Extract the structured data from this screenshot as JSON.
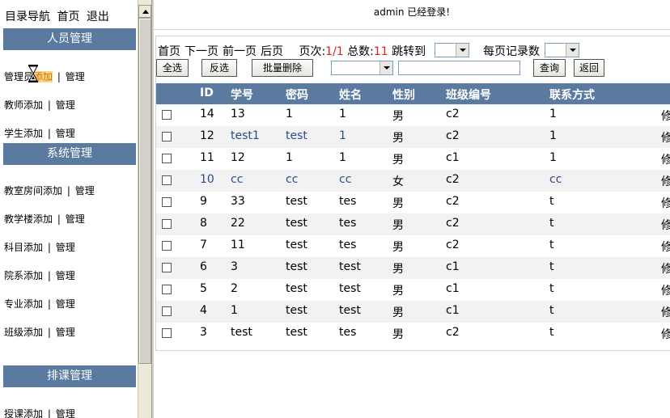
{
  "top_nav": [
    "目录导航",
    "首页",
    "退出"
  ],
  "sections": {
    "personnel": "人员管理",
    "system": "系统管理",
    "scheduling": "排课管理"
  },
  "menu": {
    "admin": {
      "prefix": "管理员",
      "add": "添加",
      "manage": "管理"
    },
    "teacher": {
      "add": "教师添加",
      "manage": "管理"
    },
    "student": {
      "add": "学生添加",
      "manage": "管理"
    },
    "classroom": {
      "add": "教室房间添加",
      "manage": "管理"
    },
    "building": {
      "add": "教学楼添加",
      "manage": "管理"
    },
    "subject": {
      "add": "科目添加",
      "manage": "管理"
    },
    "department": {
      "add": "院系添加",
      "manage": "管理"
    },
    "major": {
      "add": "专业添加",
      "manage": "管理"
    },
    "class": {
      "add": "班级添加",
      "manage": "管理"
    },
    "teaching": {
      "add": "授课添加",
      "manage": "管理"
    }
  },
  "separator": "|",
  "login_message": "admin 已经登录!",
  "pager": {
    "first": "首页",
    "next": "下一页",
    "prev": "前一页",
    "last": "后页",
    "page_label": "页次:",
    "page_value": "1/1",
    "total_label": "总数:",
    "total_value": "11",
    "jump_label": "跳转到",
    "per_page_label": "每页记录数"
  },
  "buttons": {
    "select_all": "全选",
    "invert": "反选",
    "batch_delete": "批量删除",
    "query": "查询",
    "back": "返回"
  },
  "columns": [
    "ID",
    "学号",
    "密码",
    "姓名",
    "性别",
    "班级编号",
    "联系方式"
  ],
  "rows": [
    {
      "id": "14",
      "no": "13",
      "pw": "1",
      "name": "1",
      "sex": "男",
      "class": "c2",
      "phone": "1",
      "op": "修"
    },
    {
      "id": "12",
      "no": "test1",
      "pw": "test",
      "name": "1",
      "sex": "男",
      "class": "c2",
      "phone": "1",
      "op": "修"
    },
    {
      "id": "11",
      "no": "12",
      "pw": "1",
      "name": "1",
      "sex": "男",
      "class": "c1",
      "phone": "1",
      "op": "修"
    },
    {
      "id": "10",
      "no": "cc",
      "pw": "cc",
      "name": "cc",
      "sex": "女",
      "class": "c2",
      "phone": "cc",
      "op": "修"
    },
    {
      "id": "9",
      "no": "33",
      "pw": "test",
      "name": "tes",
      "sex": "男",
      "class": "c2",
      "phone": "t",
      "op": "修"
    },
    {
      "id": "8",
      "no": "22",
      "pw": "test",
      "name": "tes",
      "sex": "男",
      "class": "c2",
      "phone": "t",
      "op": "修"
    },
    {
      "id": "7",
      "no": "11",
      "pw": "test",
      "name": "tes",
      "sex": "男",
      "class": "c2",
      "phone": "t",
      "op": "修"
    },
    {
      "id": "6",
      "no": "3",
      "pw": "test",
      "name": "test",
      "sex": "男",
      "class": "c1",
      "phone": "t",
      "op": "修"
    },
    {
      "id": "5",
      "no": "2",
      "pw": "test",
      "name": "test",
      "sex": "男",
      "class": "c1",
      "phone": "t",
      "op": "修"
    },
    {
      "id": "4",
      "no": "1",
      "pw": "test",
      "name": "test",
      "sex": "男",
      "class": "c1",
      "phone": "t",
      "op": "修"
    },
    {
      "id": "3",
      "no": "test",
      "pw": "test",
      "name": "tes",
      "sex": "男",
      "class": "c2",
      "phone": "t",
      "op": "修"
    }
  ],
  "colors": {
    "header_bg": "#5a7aa0",
    "link_blue": "#2a4b8a",
    "red": "#e02020",
    "highlight": "#f3d88a"
  }
}
